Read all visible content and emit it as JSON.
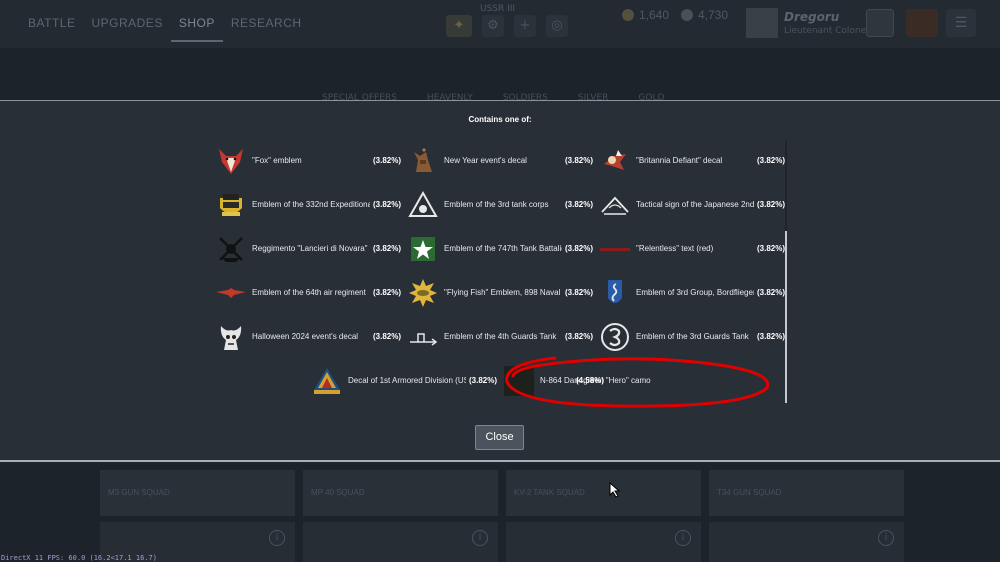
{
  "topbar": {
    "nav": [
      "BATTLE",
      "UPGRADES",
      "SHOP",
      "RESEARCH"
    ],
    "active_nav": "SHOP",
    "user_label": "USSR III",
    "golden_eagles": "1,640",
    "silver_lions": "4,730",
    "profile": {
      "name": "Dregoru",
      "rank": "Lieutenant Colonel"
    },
    "menu_icon": "☰"
  },
  "shop_tabs": [
    "SPECIAL OFFERS",
    "HEAVENLY",
    "SOLDIERS",
    "SILVER",
    "GOLD"
  ],
  "modal": {
    "title": "Contains one of:",
    "close_label": "Close",
    "rewards": [
      {
        "name": "\"Fox\" emblem",
        "chance": "(3.82%)",
        "icon": "fox-emblem-icon"
      },
      {
        "name": "New Year event's decal",
        "chance": "(3.82%)",
        "icon": "new-year-decal-icon"
      },
      {
        "name": "\"Britannia Defiant\" decal",
        "chance": "(3.82%)",
        "icon": "britannia-defiant-icon"
      },
      {
        "name": "Emblem of the 332nd Expeditionary",
        "chance": "(3.82%)",
        "icon": "332nd-emblem-icon"
      },
      {
        "name": "Emblem of the 3rd tank corps",
        "chance": "(3.82%)",
        "icon": "3rd-tank-corps-icon"
      },
      {
        "name": "Tactical sign of the Japanese 2nd",
        "chance": "(3.82%)",
        "icon": "japanese-tactical-sign-icon"
      },
      {
        "name": "Reggimento \"Lancieri di Novara\"",
        "chance": "(3.82%)",
        "icon": "lancieri-novara-icon"
      },
      {
        "name": "Emblem of the 747th Tank Battalion",
        "chance": "(3.82%)",
        "icon": "747th-emblem-icon"
      },
      {
        "name": "\"Relentless\" text (red)",
        "chance": "(3.82%)",
        "icon": "relentless-text-icon"
      },
      {
        "name": "Emblem of the 64th air regiment",
        "chance": "(3.82%)",
        "icon": "64th-air-regiment-icon"
      },
      {
        "name": "\"Flying Fish\" Emblem, 898 Naval",
        "chance": "(3.82%)",
        "icon": "flying-fish-icon"
      },
      {
        "name": "Emblem of 3rd Group, Bordflieger",
        "chance": "(3.82%)",
        "icon": "seahorse-emblem-icon"
      },
      {
        "name": "Halloween 2024 event's decal",
        "chance": "(3.82%)",
        "icon": "halloween-decal-icon"
      },
      {
        "name": "Emblem of the 4th Guards Tank",
        "chance": "(3.82%)",
        "icon": "4th-guards-tank-icon"
      },
      {
        "name": "Emblem of the 3rd Guards Tank",
        "chance": "(3.82%)",
        "icon": "3rd-guards-tank-icon"
      },
      {
        "name": "Decal of 1st Armored Division (US)",
        "chance": "(3.82%)",
        "icon": "1st-armored-division-icon"
      },
      {
        "name": "N-864 Dark green \"Hero\" camo",
        "chance": "(4.58%)",
        "icon": "camo-swatch-icon",
        "swatch_color": "#1c211b"
      }
    ]
  },
  "bottom_cards": [
    "M3 GUN SQUAD",
    "MP 40 SQUAD",
    "KV-2 TANK SQUAD",
    "T34 GUN SQUAD"
  ],
  "status_bar": "DirectX 11 FPS: 60.0 (16.2<17.1 16.7)",
  "colors": {
    "modal_bg": "#292f36",
    "annotation_red": "#e00000",
    "accent_text": "#ffffff"
  }
}
